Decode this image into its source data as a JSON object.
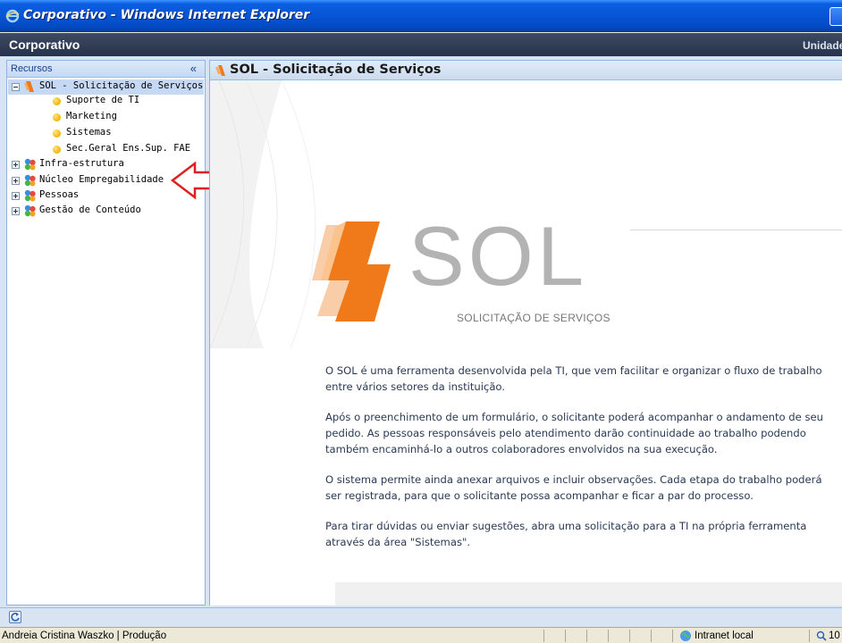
{
  "window": {
    "title": "Corporativo - Windows Internet Explorer"
  },
  "app": {
    "title": "Corporativo",
    "unit_label": "Unidade"
  },
  "sidebar": {
    "title": "Recursos",
    "collapse_glyph": "«",
    "items": [
      {
        "label": "SOL - Solicitação de Serviços",
        "icon": "sol-icon",
        "expanded": true
      },
      {
        "label": "Suporte de TI",
        "icon": "bulb-icon"
      },
      {
        "label": "Marketing",
        "icon": "bulb-icon"
      },
      {
        "label": "Sistemas",
        "icon": "bulb-icon"
      },
      {
        "label": "Sec.Geral Ens.Sup. FAE",
        "icon": "bulb-icon"
      },
      {
        "label": "Infra-estrutura",
        "icon": "modules-icon",
        "expanded": false
      },
      {
        "label": "Núcleo Empregabilidade",
        "icon": "modules-icon",
        "expanded": false
      },
      {
        "label": "Pessoas",
        "icon": "modules-icon",
        "expanded": false
      },
      {
        "label": "Gestão de Conteúdo",
        "icon": "modules-icon",
        "expanded": false
      }
    ]
  },
  "main": {
    "title": "SOL - Solicitação de Serviços",
    "logo_word": "SOL",
    "logo_subtitle": "SOLICITAÇÃO DE SERVIÇOS",
    "paragraphs": [
      "O SOL é uma ferramenta desenvolvida pela TI, que vem facilitar e organizar o fluxo de trabalho entre vários setores da instituição.",
      "Após o preenchimento de um formulário, o solicitante poderá acompanhar o andamento de seu pedido. As pessoas responsáveis pelo atendimento darão continuidade ao trabalho podendo também encaminhá-lo a outros colaboradores envolvidos na sua execução.",
      "O sistema permite ainda anexar arquivos e incluir observações. Cada etapa do trabalho poderá ser registrada, para que o solicitante possa acompanhar e ficar a par do processo.",
      "Para tirar dúvidas ou enviar sugestões, abra uma solicitação para a TI na própria ferramenta através da área \"Sistemas\"."
    ]
  },
  "statusbar": {
    "text": "Andreia Cristina Waszko | Produção",
    "zone": "Intranet local",
    "zoom": "10"
  },
  "colors": {
    "accent_orange": "#f07a1a",
    "arrow_red": "#e02020",
    "header_dark": "#26334c"
  }
}
